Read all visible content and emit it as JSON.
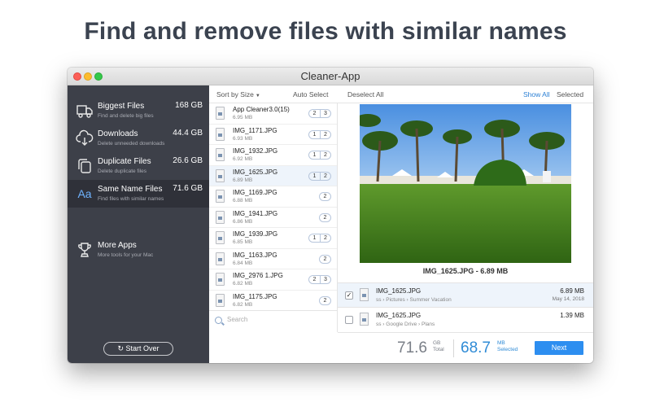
{
  "headline": "Find and remove files with similar names",
  "window": {
    "title": "Cleaner-App"
  },
  "sidebar": {
    "items": [
      {
        "title": "Biggest Files",
        "subtitle": "Find and delete big files",
        "size": "168 GB",
        "icon": "truck-icon"
      },
      {
        "title": "Downloads",
        "subtitle": "Delete unneeded downloads",
        "size": "44.4 GB",
        "icon": "cloud-download-icon"
      },
      {
        "title": "Duplicate Files",
        "subtitle": "Delete duplicate files",
        "size": "26.6 GB",
        "icon": "duplicate-icon"
      },
      {
        "title": "Same Name Files",
        "subtitle": "Find files with similar names",
        "size": "71.6 GB",
        "icon": "text-aa-icon"
      },
      {
        "title": "More Apps",
        "subtitle": "More tools for your Mac",
        "size": "",
        "icon": "trophy-icon"
      }
    ],
    "start_over": "Start Over"
  },
  "toolbar": {
    "sort": "Sort by Size",
    "auto_select": "Auto Select",
    "deselect_all": "Deselect All",
    "show_all": "Show All",
    "selected": "Selected"
  },
  "files": [
    {
      "name": "App Cleaner3.0(15)",
      "size": "6.95 MB",
      "badges": [
        "2",
        "3"
      ]
    },
    {
      "name": "IMG_1171.JPG",
      "size": "6.93 MB",
      "badges": [
        "1",
        "2"
      ]
    },
    {
      "name": "IMG_1932.JPG",
      "size": "6.92 MB",
      "badges": [
        "1",
        "2"
      ]
    },
    {
      "name": "IMG_1625.JPG",
      "size": "6.89 MB",
      "badges": [
        "1",
        "2"
      ]
    },
    {
      "name": "IMG_1169.JPG",
      "size": "6.88 MB",
      "badges": [
        "2"
      ]
    },
    {
      "name": "IMG_1941.JPG",
      "size": "6.86 MB",
      "badges": [
        "2"
      ]
    },
    {
      "name": "IMG_1939.JPG",
      "size": "6.85 MB",
      "badges": [
        "1",
        "2"
      ]
    },
    {
      "name": "IMG_1163.JPG",
      "size": "6.84 MB",
      "badges": [
        "2"
      ]
    },
    {
      "name": "IMG_2976 1.JPG",
      "size": "6.82 MB",
      "badges": [
        "2",
        "3"
      ]
    },
    {
      "name": "IMG_1175.JPG",
      "size": "6.82 MB",
      "badges": [
        "2"
      ]
    }
  ],
  "search": {
    "placeholder": "Search"
  },
  "preview": {
    "caption": "IMG_1625.JPG - 6.89 MB"
  },
  "locations": [
    {
      "name": "IMG_1625.JPG",
      "path": "ss  › Pictures  › Summer Vacation",
      "size": "6.89 MB",
      "date": "May 14, 2018",
      "checked": true
    },
    {
      "name": "IMG_1625.JPG",
      "path": "ss  › Google Drive  › Plans",
      "size": "1.39 MB",
      "date": "",
      "checked": false
    }
  ],
  "footer": {
    "total_value": "71.6",
    "total_unit": "GB",
    "total_label": "Total",
    "selected_value": "68.7",
    "selected_unit": "MB",
    "selected_label": "Selected",
    "next": "Next"
  }
}
